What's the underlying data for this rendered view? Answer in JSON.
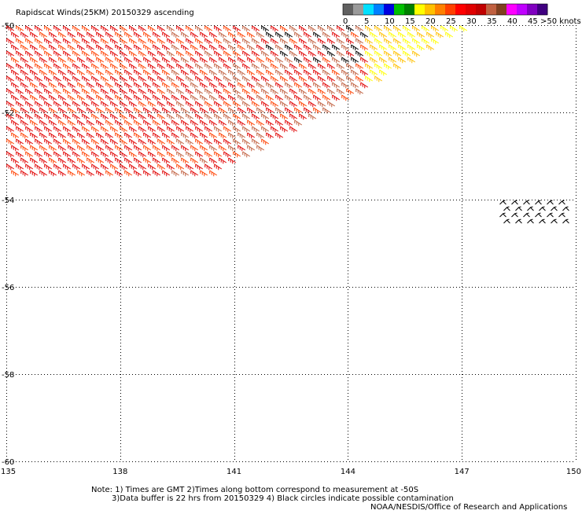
{
  "title": "Rapidscat Winds(25KM) 20150329 ascending",
  "colorbar": {
    "units": ">50 knots",
    "ticks": [
      "0",
      "5",
      "10",
      "15",
      "20",
      "25",
      "30",
      "35",
      "40",
      "45"
    ],
    "colors": [
      "#606060",
      "#9a9a9a",
      "#00e0ff",
      "#0080ff",
      "#0000e0",
      "#00c000",
      "#008000",
      "#ffff00",
      "#ffc000",
      "#ff8000",
      "#ff4000",
      "#ff0000",
      "#e00000",
      "#c00000",
      "#c06040",
      "#804020",
      "#ff00ff",
      "#c000ff",
      "#8000c0",
      "#400080"
    ]
  },
  "map": {
    "lon_range": [
      135,
      150
    ],
    "lat_range": [
      -60,
      -50
    ],
    "lon_ticks": [
      "135",
      "138",
      "141",
      "144",
      "147",
      "150"
    ],
    "lat_ticks": [
      "-50",
      "-52",
      "-54",
      "-56",
      "-58",
      "-60"
    ],
    "lon_tick_values": [
      135,
      138,
      141,
      144,
      147,
      150
    ],
    "lat_tick_values": [
      -50,
      -52,
      -54,
      -56,
      -58,
      -60
    ]
  },
  "wind_swath": {
    "area_lon_range": [
      135,
      147
    ],
    "area_lat_range": [
      -53.4,
      -50
    ],
    "dominant_colors": [
      "#e00000",
      "#ff4000",
      "#c06040",
      "#000000",
      "#ffc000",
      "#ffff00"
    ],
    "black_barb_cluster_lon_range": [
      148,
      150
    ],
    "black_barb_cluster_lat_range": [
      -54.4,
      -54
    ]
  },
  "notes": {
    "line1": "Note: 1) Times are GMT 2)Times along bottom correspond to measurement at -50S",
    "line2": "3)Data buffer is 22 hrs from 20150329 4) Black circles indicate possible contamination",
    "credit": "NOAA/NESDIS/Office of Research and Applications"
  }
}
